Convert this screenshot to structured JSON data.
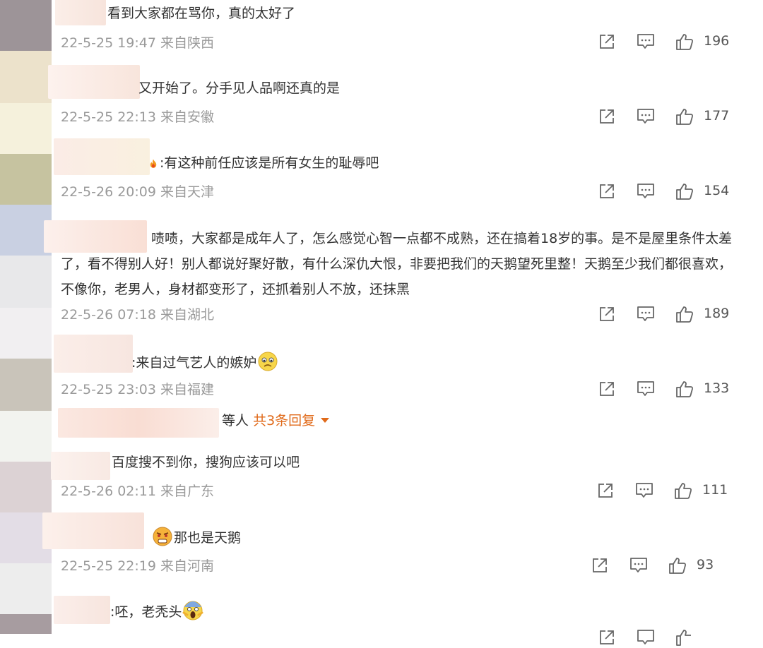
{
  "comments": [
    {
      "text": "看到大家都在骂你，真的太好了",
      "time": "22-5-25 19:47",
      "location": "来自陕西",
      "likes": "196"
    },
    {
      "text": "又开始了。分手见人品啊还真的是",
      "time": "22-5-25 22:13",
      "location": "来自安徽",
      "likes": "177"
    },
    {
      "text": ":有这种前任应该是所有女生的耻辱吧",
      "time": "22-5-26 20:09",
      "location": "来自天津",
      "likes": "154"
    },
    {
      "text": "啧啧，大家都是成年人了，怎么感觉心智一点都不成熟，还在搞着18岁的事。是不是屋里条件太差了，看不得别人好！别人都说好聚好散，有什么深仇大恨，非要把我们的天鹅望死里整！天鹅至少我们都很喜欢，不像你，老男人，身材都变形了，还抓着别人不放，还抹黑",
      "time": "22-5-26 07:18",
      "location": "来自湖北",
      "likes": "189"
    },
    {
      "text": ":来自过气艺人的嫉妒",
      "time": "22-5-25 23:03",
      "location": "来自福建",
      "likes": "133"
    }
  ],
  "reply_summary": {
    "suffix": "等人",
    "count_label": "共3条回复"
  },
  "replies": [
    {
      "text": "百度搜不到你，搜狗应该可以吧",
      "time": "22-5-26 02:11",
      "location": "来自广东",
      "likes": "111"
    },
    {
      "text": "那也是天鹅",
      "time": "22-5-25 22:19",
      "location": "来自河南",
      "likes": "93"
    },
    {
      "text": ":呸，老秃头",
      "time": "",
      "location": "",
      "likes": ""
    }
  ],
  "icons": [
    "share-icon",
    "comment-icon",
    "like-icon"
  ],
  "colors": {
    "meta_text": "#9a9a9a",
    "accent": "#e06a1a",
    "body_text": "#333333"
  }
}
